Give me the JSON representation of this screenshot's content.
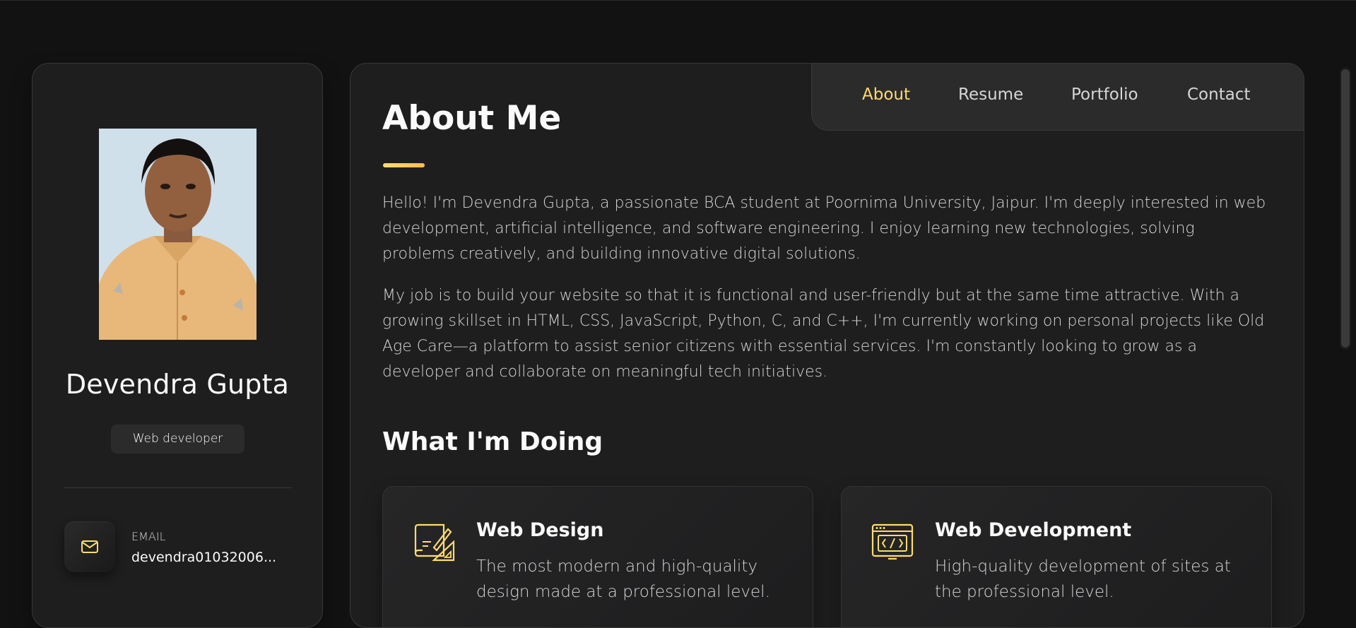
{
  "colors": {
    "page_bg": "#121212",
    "panel_bg": "#1e1e1f",
    "accent": "#ffdb70",
    "text_primary": "#fafafa",
    "text_secondary": "#d6d6d6"
  },
  "sidebar": {
    "name": "Devendra Gupta",
    "title": "Web developer",
    "avatar_icon": "profile-photo",
    "contacts": [
      {
        "icon": "mail-icon",
        "label": "Email",
        "value": "devendra01032006..."
      }
    ]
  },
  "navbar": {
    "items": [
      {
        "label": "About",
        "active": true
      },
      {
        "label": "Resume",
        "active": false
      },
      {
        "label": "Portfolio",
        "active": false
      },
      {
        "label": "Contact",
        "active": false
      }
    ]
  },
  "about": {
    "title": "About Me",
    "paragraphs": [
      "Hello! I'm Devendra Gupta, a passionate BCA student at Poornima University, Jaipur. I'm deeply interested in web development, artificial intelligence, and software engineering. I enjoy learning new technologies, solving problems creatively, and building innovative digital solutions.",
      "My job is to build your website so that it is functional and user-friendly but at the same time attractive. With a growing skillset in HTML, CSS, JavaScript, Python, C, and C++, I'm currently working on personal projects like Old Age Care—a platform to assist senior citizens with essential services. I'm constantly looking to grow as a developer and collaborate on meaningful tech initiatives."
    ]
  },
  "services": {
    "title": "What I'm Doing",
    "items": [
      {
        "icon": "design-tools-icon",
        "title": "Web Design",
        "text": "The most modern and high-quality design made at a professional level."
      },
      {
        "icon": "code-window-icon",
        "title": "Web Development",
        "text": "High-quality development of sites at the professional level."
      }
    ]
  }
}
